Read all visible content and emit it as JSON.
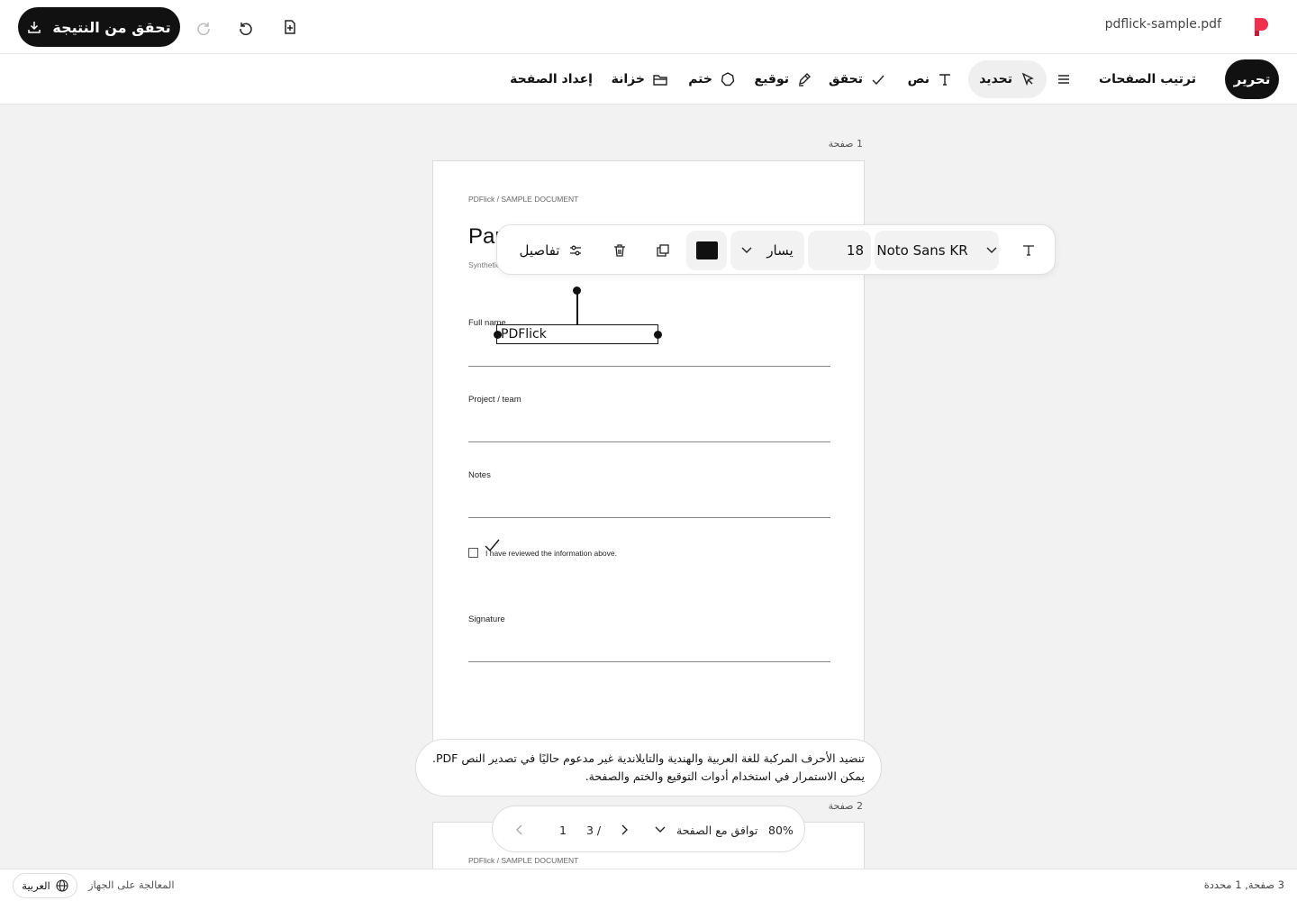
{
  "app": {
    "filename": "pdflick-sample.pdf",
    "brand_color": "#f0304f"
  },
  "topbar": {
    "export_label": "تحقق من النتيجة"
  },
  "toolbar": {
    "edit_label": "تحرير",
    "arrange_label": "ترتيب الصفحات",
    "select_label": "تحديد",
    "text_label": "نص",
    "verify_label": "تحقق",
    "sign_label": "توقيع",
    "stamp_label": "ختم",
    "storage_label": "خزانة",
    "page_setup_label": "إعداد الصفحة"
  },
  "pages": {
    "page1_label": "1 صفحة",
    "page2_label": "2 صفحة"
  },
  "document": {
    "header": "PDFlick / SAMPLE DOCUMENT",
    "title": "Par",
    "subtitle": "Synthetic",
    "fields": [
      "Full name",
      "Project / team",
      "Notes",
      "Signature"
    ],
    "checkbox_text": "I have reviewed the information above.",
    "selected_text": "PDFlick"
  },
  "text_toolbar": {
    "font": "Noto Sans KR",
    "size": "18",
    "align": "يسار",
    "details_label": "تفاصيل",
    "color": "#111111"
  },
  "toast": {
    "line1": "تنضيد الأحرف المركبة للغة العربية والهندية والتايلاندية غير مدعوم حاليًا في تصدير النص PDF.",
    "line2": "يمكن الاستمرار في استخدام أدوات التوقيع والختم والصفحة."
  },
  "pager": {
    "zoom": "80%",
    "fit_label": "توافق مع الصفحة",
    "total": "3 /",
    "current": "1"
  },
  "status": {
    "pages_info": "3 صفحة, 1 محددة",
    "processing": "المعالجة على الجهاز",
    "language": "العربية"
  }
}
